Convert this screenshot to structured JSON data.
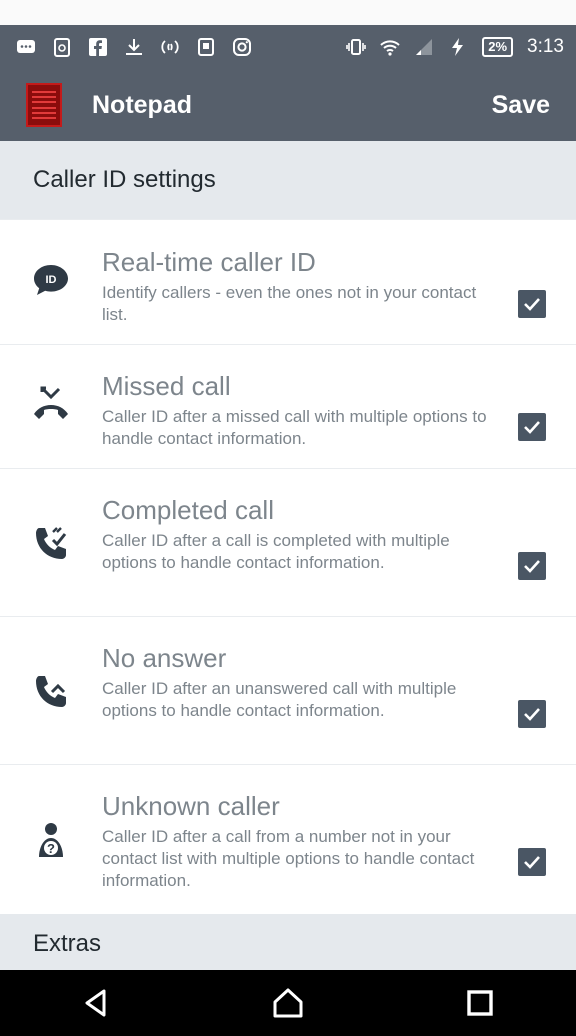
{
  "status_bar": {
    "battery_percent": "2%",
    "time": "3:13",
    "icons": [
      "message-icon",
      "clipboard-icon",
      "facebook-icon",
      "download-icon",
      "sync-icon",
      "sim-icon",
      "instagram-icon",
      "vibrate-icon",
      "wifi-icon",
      "signal-icon",
      "charging-icon"
    ]
  },
  "app_bar": {
    "title": "Notepad",
    "save_label": "Save",
    "logo_icon": "notepad-logo-icon"
  },
  "sections": {
    "caller_id": "Caller ID settings",
    "extras": "Extras"
  },
  "settings": [
    {
      "icon": "id-bubble-icon",
      "title": "Real-time caller ID",
      "description": "Identify callers - even the ones not in your contact list.",
      "checked": true
    },
    {
      "icon": "missed-call-icon",
      "title": "Missed call",
      "description": "Caller ID after a missed call with multiple options to handle contact information.",
      "checked": true
    },
    {
      "icon": "completed-call-icon",
      "title": "Completed call",
      "description": "Caller ID after a call is completed with multiple options to handle contact information.",
      "checked": true
    },
    {
      "icon": "no-answer-icon",
      "title": "No answer",
      "description": "Caller ID after an unanswered call with multiple options to handle contact information.",
      "checked": true
    },
    {
      "icon": "unknown-caller-icon",
      "title": "Unknown caller",
      "description": "Caller ID after a call from a number not in your contact list with multiple options to handle contact information.",
      "checked": true
    }
  ],
  "colors": {
    "app_bar": "#565f6b",
    "section_header": "#e5e9ed",
    "checkbox": "#4a5664",
    "icon": "#2f3a45"
  },
  "nav_bar": {
    "icons": [
      "back-icon",
      "home-icon",
      "recents-icon"
    ]
  }
}
